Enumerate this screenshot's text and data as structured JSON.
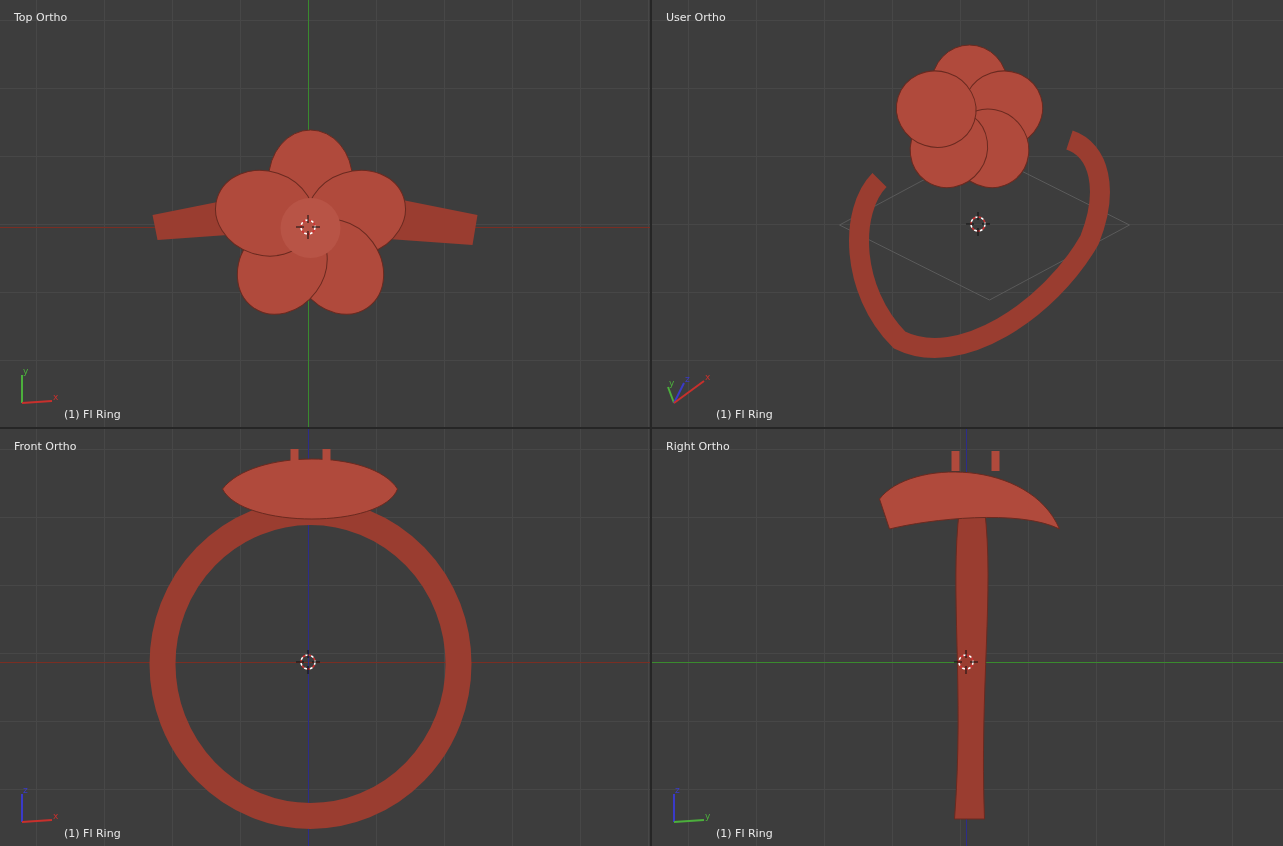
{
  "viewports": [
    {
      "kind": "top",
      "title": "Top Ortho",
      "object_label": "(1) Fl Ring",
      "axes": [
        {
          "label": "y",
          "color": "#4caf3c"
        },
        {
          "label": "x",
          "color": "#c8302c"
        }
      ]
    },
    {
      "kind": "user",
      "title": "User Ortho",
      "object_label": "(1) Fl Ring",
      "axes": [
        {
          "label": "y",
          "color": "#4caf3c"
        },
        {
          "label": "z",
          "color": "#3a3ac8"
        },
        {
          "label": "x",
          "color": "#c8302c"
        }
      ]
    },
    {
      "kind": "front",
      "title": "Front Ortho",
      "object_label": "(1) Fl Ring",
      "axes": [
        {
          "label": "z",
          "color": "#3a3ac8"
        },
        {
          "label": "x",
          "color": "#c8302c"
        }
      ]
    },
    {
      "kind": "right",
      "title": "Right Ortho",
      "object_label": "(1) Fl Ring",
      "axes": [
        {
          "label": "z",
          "color": "#3a3ac8"
        },
        {
          "label": "y",
          "color": "#4caf3c"
        }
      ]
    }
  ]
}
